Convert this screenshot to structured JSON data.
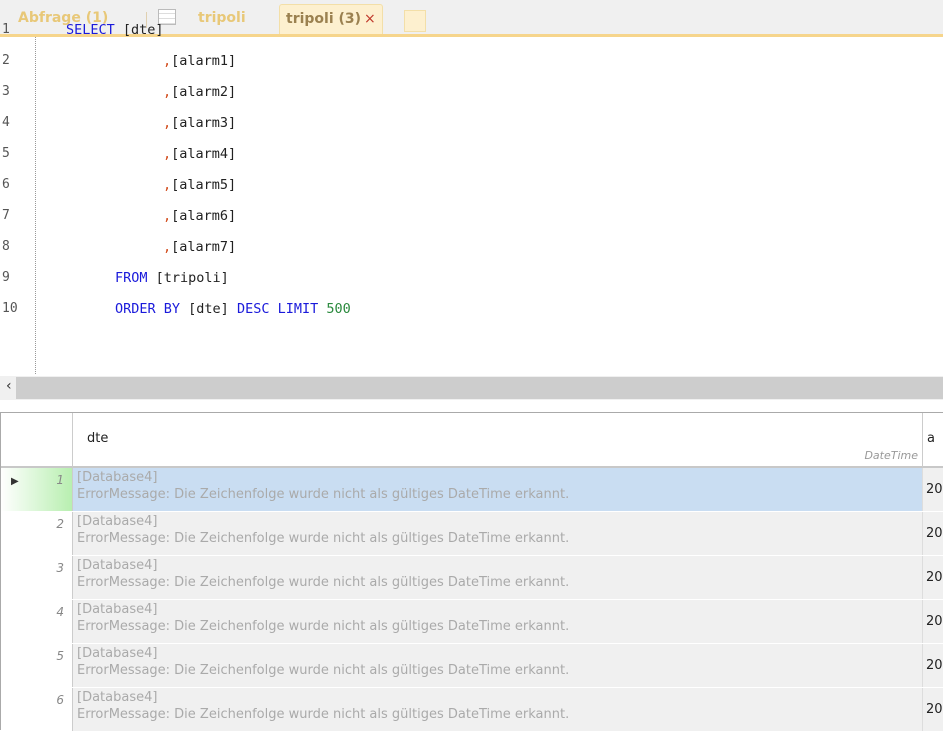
{
  "tabs": [
    {
      "label": "Abfrage (1)"
    },
    {
      "label": "tripoli",
      "icon": "table-edit-icon"
    },
    {
      "label": "tripoli (3)",
      "active": true,
      "close": "×"
    }
  ],
  "editor": {
    "line_numbers": [
      "1",
      "2",
      "3",
      "4",
      "5",
      "6",
      "7",
      "8",
      "9",
      "10"
    ],
    "lines": {
      "l1_kw": "SELECT",
      "l1_rest": " [dte]",
      "c": ",",
      "l2": "[alarm1]",
      "l3": "[alarm2]",
      "l4": "[alarm3]",
      "l5": "[alarm4]",
      "l6": "[alarm5]",
      "l7": "[alarm6]",
      "l8": "[alarm7]",
      "l9_kw": "FROM",
      "l9_rest": " [tripoli]",
      "l10_kw1": "ORDER BY",
      "l10_mid": " [dte] ",
      "l10_kw2": "DESC LIMIT",
      "l10_num": " 500"
    }
  },
  "scrollbar": {
    "left_arrow": "‹"
  },
  "grid": {
    "columns": [
      {
        "name": "dte",
        "type": "DateTime"
      },
      {
        "name": "a"
      }
    ],
    "rows": [
      {
        "n": "1",
        "l1": "[Database4]",
        "l2": "ErrorMessage: Die Zeichenfolge wurde nicht als gültiges DateTime erkannt.",
        "c2": "20"
      },
      {
        "n": "2",
        "l1": "[Database4]",
        "l2": "ErrorMessage: Die Zeichenfolge wurde nicht als gültiges DateTime erkannt.",
        "c2": "20"
      },
      {
        "n": "3",
        "l1": "[Database4]",
        "l2": "ErrorMessage: Die Zeichenfolge wurde nicht als gültiges DateTime erkannt.",
        "c2": "20"
      },
      {
        "n": "4",
        "l1": "[Database4]",
        "l2": "ErrorMessage: Die Zeichenfolge wurde nicht als gültiges DateTime erkannt.",
        "c2": "20"
      },
      {
        "n": "5",
        "l1": "[Database4]",
        "l2": "ErrorMessage: Die Zeichenfolge wurde nicht als gültiges DateTime erkannt.",
        "c2": "20"
      },
      {
        "n": "6",
        "l1": "[Database4]",
        "l2": "ErrorMessage: Die Zeichenfolge wurde nicht als gültiges DateTime erkannt.",
        "c2": "20"
      }
    ]
  }
}
